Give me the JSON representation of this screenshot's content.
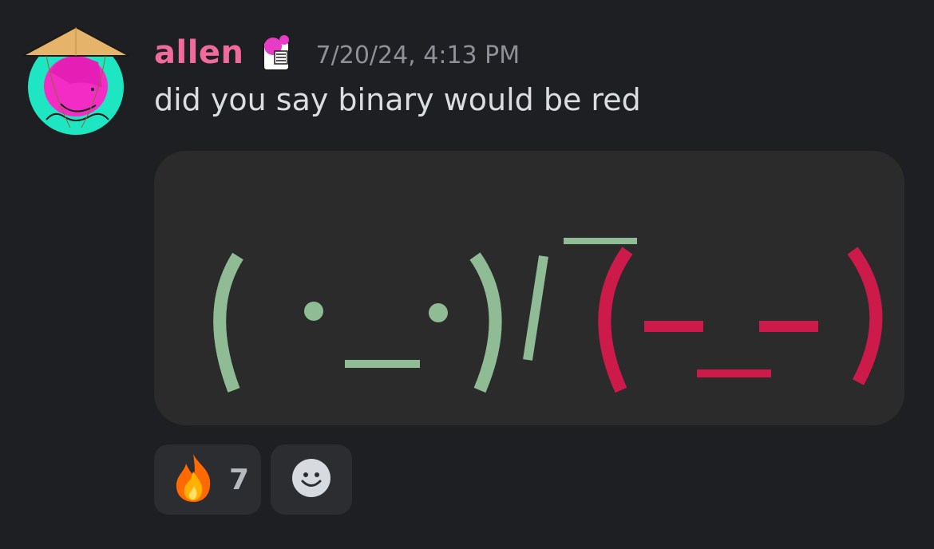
{
  "message": {
    "author": "allen",
    "timestamp": "7/20/24, 4:13 PM",
    "content": "did you say binary would be red",
    "author_color": "#f06a9a",
    "avatar_icon": "avatar-straw-hat-pink-boy",
    "role_icon": "role-badge-icon"
  },
  "embed": {
    "kaomoji": "( ·_·)/¯(-_-)",
    "left_color": "#8fbc94",
    "right_color": "#cc1a4a",
    "background": "#2b2b2b"
  },
  "reactions": [
    {
      "emoji": "fire",
      "count": "7"
    },
    {
      "emoji": "add-reaction",
      "count": ""
    }
  ]
}
